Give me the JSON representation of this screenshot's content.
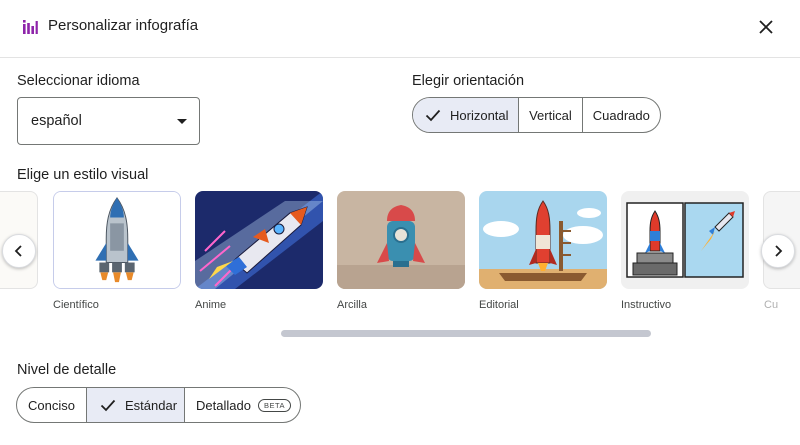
{
  "header": {
    "title": "Personalizar infografía",
    "app_icon": "infographic-icon",
    "close_icon": "close-icon"
  },
  "language": {
    "label": "Seleccionar idioma",
    "value": "español"
  },
  "orientation": {
    "label": "Elegir orientación",
    "options": [
      "Horizontal",
      "Vertical",
      "Cuadrado"
    ],
    "selected": "Horizontal"
  },
  "style": {
    "label": "Elige un estilo visual",
    "cards": [
      {
        "label": "Científico"
      },
      {
        "label": "Anime"
      },
      {
        "label": "Arcilla"
      },
      {
        "label": "Editorial"
      },
      {
        "label": "Instructivo"
      },
      {
        "label": "Cu"
      }
    ],
    "selected": "Científico"
  },
  "detail": {
    "label": "Nivel de detalle",
    "options": [
      "Conciso",
      "Estándar",
      "Detallado"
    ],
    "selected": "Estándar",
    "beta_badge": "BETA"
  },
  "colors": {
    "accent": "#8e24aa",
    "selected_bg": "#e8ebf5",
    "border": "#747775"
  }
}
